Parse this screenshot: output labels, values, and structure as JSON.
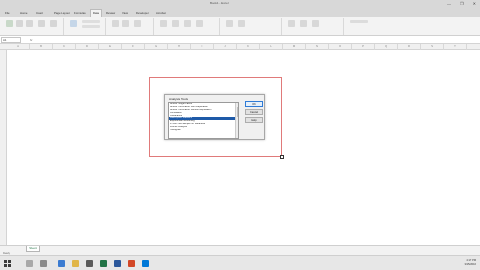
{
  "window": {
    "title": "Book1 - Excel",
    "controls": [
      "—",
      "❐",
      "✕"
    ]
  },
  "ribbon_tabs": [
    "File",
    "Home",
    "Insert",
    "Page Layout",
    "Formulas",
    "Data",
    "Review",
    "View",
    "Developer",
    "Acrobat"
  ],
  "active_tab_index": 5,
  "formula_bar": {
    "name_box": "A1",
    "fx": "fx",
    "value": ""
  },
  "columns": [
    "A",
    "B",
    "C",
    "D",
    "E",
    "F",
    "G",
    "H",
    "I",
    "J",
    "K",
    "L",
    "M",
    "N",
    "O",
    "P",
    "Q",
    "R",
    "S",
    "T"
  ],
  "dialog": {
    "title": "Analysis Tools",
    "items": [
      "Anova: Single Factor",
      "Anova: Two-Factor With Replication",
      "Anova: Two-Factor Without Replication",
      "Correlation",
      "Covariance",
      "Descriptive Statistics",
      "Exponential Smoothing",
      "F-Test Two-Sample for Variances",
      "Fourier Analysis",
      "Histogram"
    ],
    "selected_index": 5,
    "buttons": {
      "ok": "OK",
      "cancel": "Cancel",
      "help": "Help"
    }
  },
  "status": {
    "sheet_tab": "Sheet1",
    "left_text": "Ready"
  },
  "taskbar": {
    "time": "4:17 PM",
    "date": "3/15/2016"
  },
  "colors": {
    "accent": "#217346",
    "selection": "#1e5aa8",
    "highlight_border": "#e07a7a"
  }
}
